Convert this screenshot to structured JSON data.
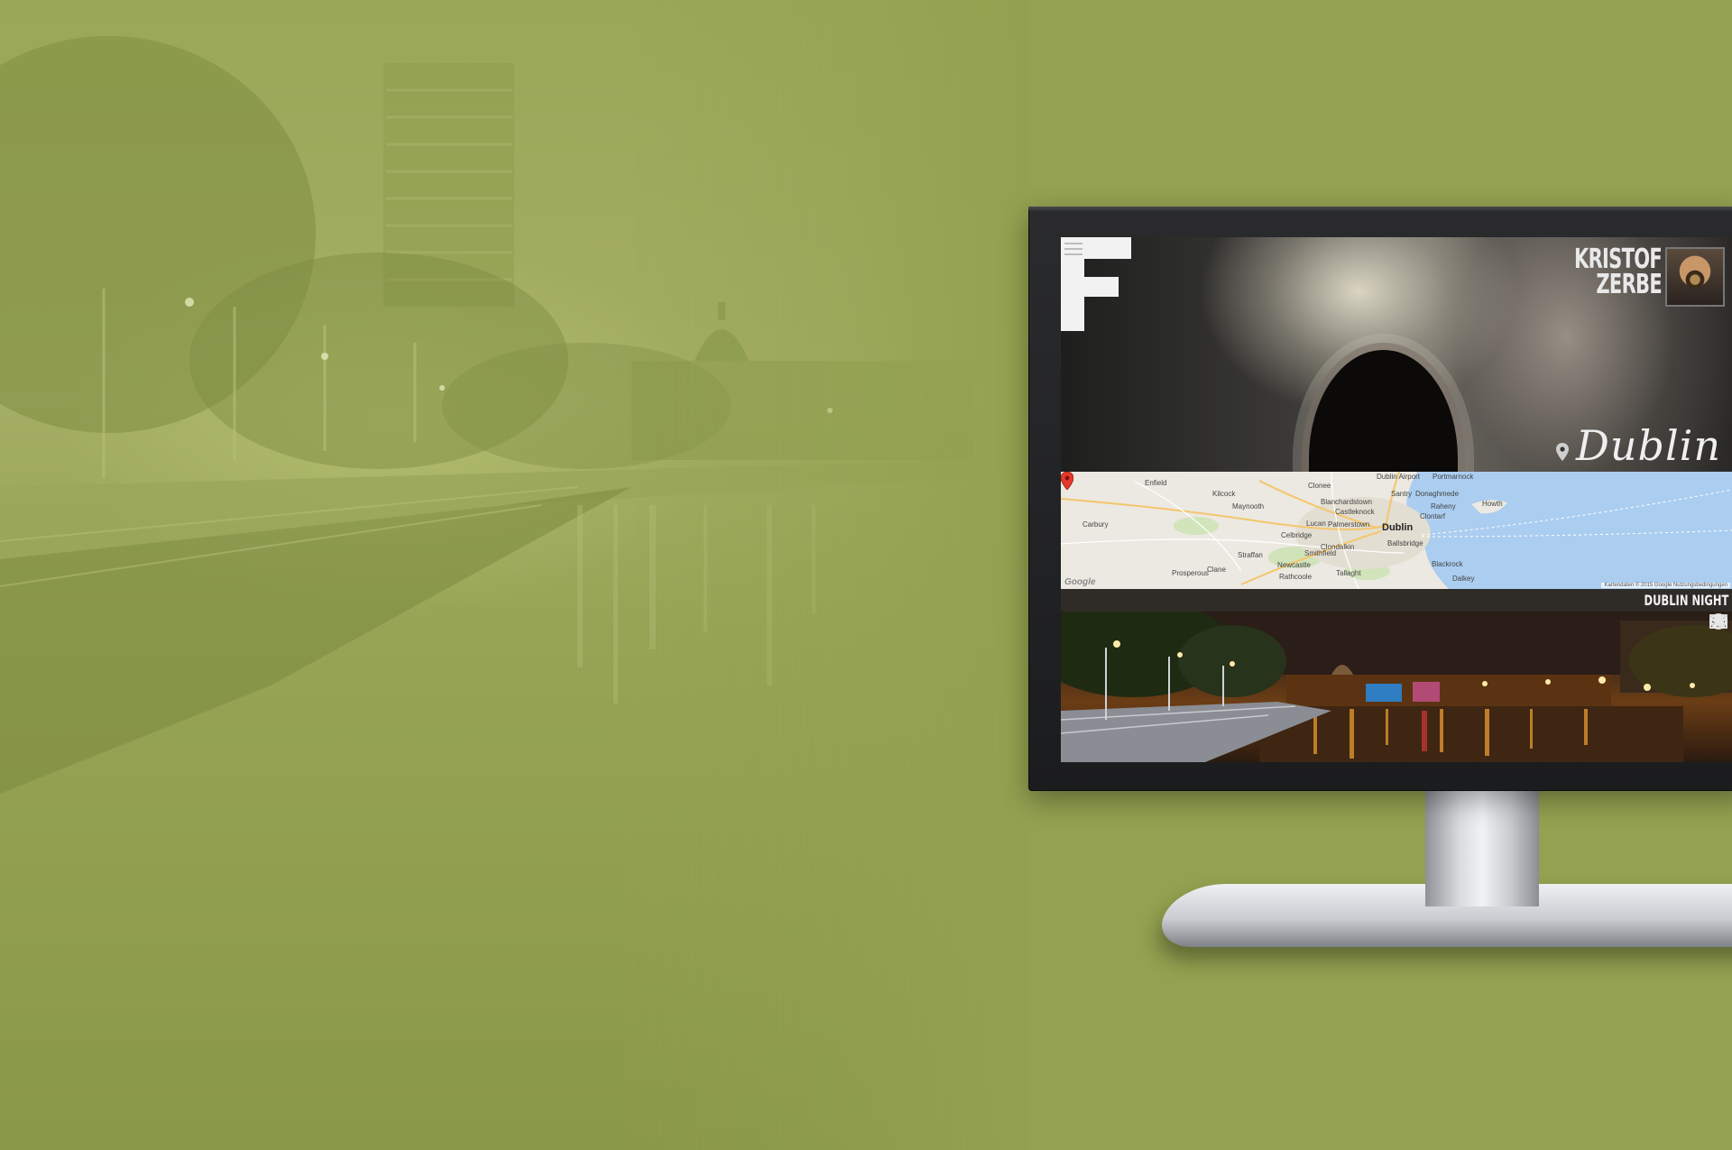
{
  "site": {
    "logo_letter": "F",
    "menu_icon": "hamburger-menu-icon"
  },
  "brand": {
    "first_name": "KRISTOF",
    "last_name": "ZERBE"
  },
  "hero": {
    "city": "Dublin",
    "location_icon": "map-pin-icon"
  },
  "map": {
    "labels": [
      "Dublin Airport",
      "Portmarnock",
      "Enfield",
      "Kilcock",
      "Clonee",
      "Santry",
      "Donaghmede",
      "Maynooth",
      "Blanchardstown",
      "Raheny",
      "Castleknock",
      "Howth",
      "Clontarf",
      "Carbury",
      "Lucan",
      "Palmerstown",
      "Dublin",
      "Celbridge",
      "Ballsbridge",
      "Clondalkin",
      "Straffan",
      "Smithfield",
      "Newcastle",
      "Blackrock",
      "Prosperous",
      "Clane",
      "Rathcoole",
      "Tallaght",
      "Dalkey"
    ],
    "google_label": "Google",
    "attribution": "Kartendaten © 2015 Google   Nutzungsbedingungen"
  },
  "gallery": {
    "title": "DUBLIN NIGHT",
    "side_icons": [
      "eye-icon",
      "image-icon",
      "camera-icon",
      "lens-icon",
      "star-icon"
    ]
  },
  "colors": {
    "background": "#93a150",
    "bezel": "#1f2022",
    "map_water": "#abcdf0",
    "map_land": "#eceae3"
  }
}
